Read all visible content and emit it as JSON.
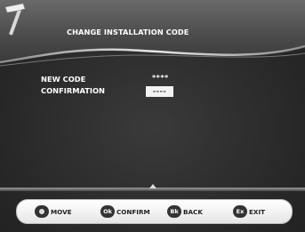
{
  "header": {
    "title": "CHANGE INSTALLATION CODE",
    "icon": "hammer-icon"
  },
  "form": {
    "new_code_label": "NEW CODE",
    "new_code_value": "****",
    "confirmation_label": "CONFIRMATION",
    "confirmation_value": "----"
  },
  "footer": {
    "move": {
      "key": "",
      "label": "MOVE",
      "icon": "dpad-icon"
    },
    "confirm": {
      "key": "Ok",
      "label": "CONFIRM"
    },
    "back": {
      "key": "Bk",
      "label": "BACK"
    },
    "exit": {
      "key": "Ex",
      "label": "EXIT"
    }
  }
}
